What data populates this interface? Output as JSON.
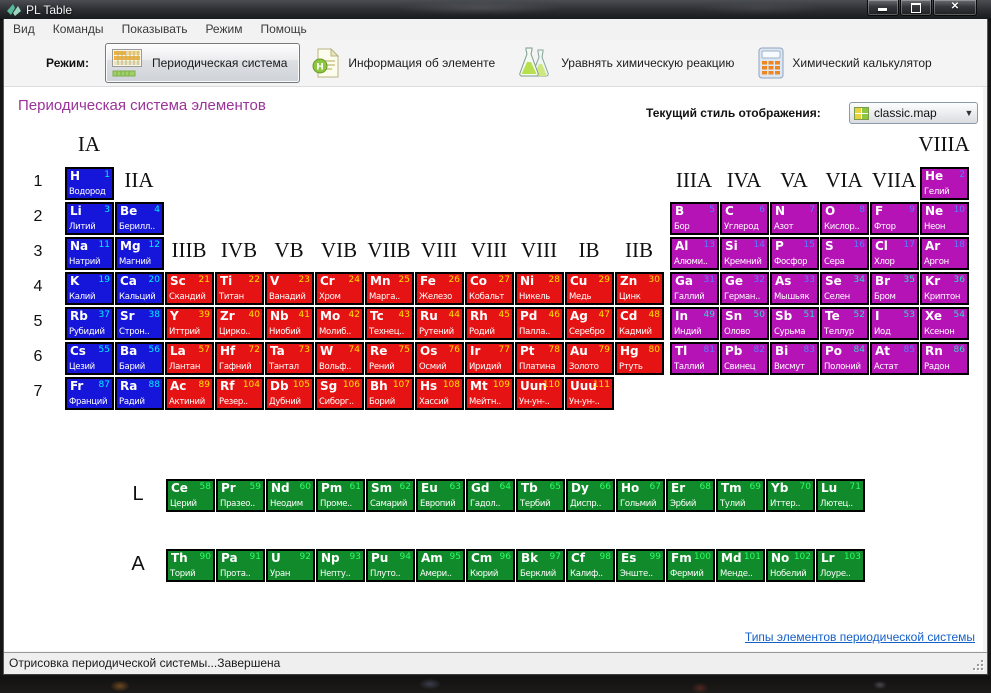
{
  "window": {
    "title": "PL Table"
  },
  "menu": {
    "items": [
      {
        "key": "view",
        "label": "Вид"
      },
      {
        "key": "commands",
        "label": "Команды"
      },
      {
        "key": "show",
        "label": "Показывать"
      },
      {
        "key": "mode",
        "label": "Режим"
      },
      {
        "key": "help",
        "label": "Помощь"
      }
    ]
  },
  "toolbar": {
    "mode_label": "Режим:",
    "buttons": [
      {
        "key": "periodic-system",
        "label": "Периодическая система",
        "icon": "periodic-table-icon",
        "selected": true
      },
      {
        "key": "element-info",
        "label": "Информация об элементе",
        "icon": "element-info-icon",
        "selected": false
      },
      {
        "key": "balance-reaction",
        "label": "Уравнять химическую реакцию",
        "icon": "flask-icon",
        "selected": false
      },
      {
        "key": "chem-calculator",
        "label": "Химический калькулятор",
        "icon": "calculator-icon",
        "selected": false
      }
    ]
  },
  "content": {
    "heading": "Периодическая система элементов",
    "style_label": "Текущий стиль отображения:",
    "style_value": "classic.map",
    "footer_link": "Типы элементов периодической системы"
  },
  "statusbar": {
    "text": "Отрисовка периодической системы...Завершена"
  },
  "table": {
    "colors": {
      "s": "#1616DA",
      "d": "#E51313",
      "p": "#B513B5",
      "f": "#108A2A"
    },
    "num_colors": {
      "s": "#00F0FF",
      "d": "#FFE000",
      "p": "#5A7CFF",
      "f": "#2BFF66",
      "cyan": "#2FD9C8"
    },
    "period_labels": [
      "1",
      "2",
      "3",
      "4",
      "5",
      "6",
      "7"
    ],
    "series_labels": [
      {
        "label": "L",
        "row": "L"
      },
      {
        "label": "A",
        "row": "A"
      }
    ],
    "group_labels": [
      {
        "text": "IA",
        "col": 1,
        "lv": "top"
      },
      {
        "text": "IIA",
        "col": 2,
        "lv": "row1"
      },
      {
        "text": "IIIB",
        "col": 3,
        "lv": "row3"
      },
      {
        "text": "IVB",
        "col": 4,
        "lv": "row3"
      },
      {
        "text": "VB",
        "col": 5,
        "lv": "row3"
      },
      {
        "text": "VIB",
        "col": 6,
        "lv": "row3"
      },
      {
        "text": "VIIB",
        "col": 7,
        "lv": "row3"
      },
      {
        "text": "VIII",
        "col": 8,
        "lv": "row3"
      },
      {
        "text": "VIII",
        "col": 9,
        "lv": "row3"
      },
      {
        "text": "VIII",
        "col": 10,
        "lv": "row3"
      },
      {
        "text": "IB",
        "col": 11,
        "lv": "row3"
      },
      {
        "text": "IIB",
        "col": 12,
        "lv": "row3"
      },
      {
        "text": "IIIA",
        "col": 13,
        "lv": "row1"
      },
      {
        "text": "IVA",
        "col": 14,
        "lv": "row1"
      },
      {
        "text": "VA",
        "col": 15,
        "lv": "row1"
      },
      {
        "text": "VIA",
        "col": 16,
        "lv": "row1"
      },
      {
        "text": "VIIA",
        "col": 17,
        "lv": "row1"
      },
      {
        "text": "VIIIA",
        "col": 18,
        "lv": "top"
      }
    ],
    "elements": [
      {
        "s": "H",
        "n": 1,
        "nm": "Водород",
        "b": "s",
        "p": 1,
        "c": 1
      },
      {
        "s": "He",
        "n": 2,
        "nm": "Гелий",
        "b": "p",
        "p": 1,
        "c": 18
      },
      {
        "s": "Li",
        "n": 3,
        "nm": "Литий",
        "b": "s",
        "p": 2,
        "c": 1
      },
      {
        "s": "Be",
        "n": 4,
        "nm": "Берилл..",
        "b": "s",
        "p": 2,
        "c": 2
      },
      {
        "s": "B",
        "n": 5,
        "nm": "Бор",
        "b": "p",
        "p": 2,
        "c": 13
      },
      {
        "s": "C",
        "n": 6,
        "nm": "Углерод",
        "b": "p",
        "p": 2,
        "c": 14
      },
      {
        "s": "N",
        "n": 7,
        "nm": "Азот",
        "b": "p",
        "p": 2,
        "c": 15
      },
      {
        "s": "O",
        "n": 8,
        "nm": "Кислор..",
        "b": "p",
        "p": 2,
        "c": 16
      },
      {
        "s": "F",
        "n": 9,
        "nm": "Фтор",
        "b": "p",
        "p": 2,
        "c": 17
      },
      {
        "s": "Ne",
        "n": 10,
        "nm": "Неон",
        "b": "p",
        "p": 2,
        "c": 18
      },
      {
        "s": "Na",
        "n": 11,
        "nm": "Натрий",
        "b": "s",
        "p": 3,
        "c": 1
      },
      {
        "s": "Mg",
        "n": 12,
        "nm": "Магний",
        "b": "s",
        "p": 3,
        "c": 2
      },
      {
        "s": "Al",
        "n": 13,
        "nm": "Алюми..",
        "b": "p",
        "p": 3,
        "c": 13
      },
      {
        "s": "Si",
        "n": 14,
        "nm": "Кремний",
        "b": "p",
        "p": 3,
        "c": 14
      },
      {
        "s": "P",
        "n": 15,
        "nm": "Фосфор",
        "b": "p",
        "p": 3,
        "c": 15
      },
      {
        "s": "S",
        "n": 16,
        "nm": "Сера",
        "b": "p",
        "p": 3,
        "c": 16
      },
      {
        "s": "Cl",
        "n": 17,
        "nm": "Хлор",
        "b": "p",
        "p": 3,
        "c": 17
      },
      {
        "s": "Ar",
        "n": 18,
        "nm": "Аргон",
        "b": "p",
        "p": 3,
        "c": 18
      },
      {
        "s": "K",
        "n": 19,
        "nm": "Калий",
        "b": "s",
        "p": 4,
        "c": 1
      },
      {
        "s": "Ca",
        "n": 20,
        "nm": "Кальций",
        "b": "s",
        "p": 4,
        "c": 2
      },
      {
        "s": "Sc",
        "n": 21,
        "nm": "Скандий",
        "b": "d",
        "p": 4,
        "c": 3
      },
      {
        "s": "Ti",
        "n": 22,
        "nm": "Титан",
        "b": "d",
        "p": 4,
        "c": 4
      },
      {
        "s": "V",
        "n": 23,
        "nm": "Ванадий",
        "b": "d",
        "p": 4,
        "c": 5
      },
      {
        "s": "Cr",
        "n": 24,
        "nm": "Хром",
        "b": "d",
        "p": 4,
        "c": 6
      },
      {
        "s": "Mn",
        "n": 25,
        "nm": "Марга..",
        "b": "d",
        "p": 4,
        "c": 7
      },
      {
        "s": "Fe",
        "n": 26,
        "nm": "Железо",
        "b": "d",
        "p": 4,
        "c": 8
      },
      {
        "s": "Co",
        "n": 27,
        "nm": "Кобальт",
        "b": "d",
        "p": 4,
        "c": 9
      },
      {
        "s": "Ni",
        "n": 28,
        "nm": "Никель",
        "b": "d",
        "p": 4,
        "c": 10
      },
      {
        "s": "Cu",
        "n": 29,
        "nm": "Медь",
        "b": "d",
        "p": 4,
        "c": 11
      },
      {
        "s": "Zn",
        "n": 30,
        "nm": "Цинк",
        "b": "d",
        "p": 4,
        "c": 12
      },
      {
        "s": "Ga",
        "n": 31,
        "nm": "Галлий",
        "b": "p",
        "p": 4,
        "c": 13
      },
      {
        "s": "Ge",
        "n": 32,
        "nm": "Герман..",
        "b": "p",
        "p": 4,
        "c": 14
      },
      {
        "s": "As",
        "n": 33,
        "nm": "Мышьяк",
        "b": "p",
        "p": 4,
        "c": 15
      },
      {
        "s": "Se",
        "n": 34,
        "nm": "Селен",
        "b": "p",
        "p": 4,
        "c": 16,
        "nc": "cyan"
      },
      {
        "s": "Br",
        "n": 35,
        "nm": "Бром",
        "b": "p",
        "p": 4,
        "c": 17,
        "nc": "cyan"
      },
      {
        "s": "Kr",
        "n": 36,
        "nm": "Криптон",
        "b": "p",
        "p": 4,
        "c": 18,
        "nc": "cyan"
      },
      {
        "s": "Rb",
        "n": 37,
        "nm": "Рубидий",
        "b": "s",
        "p": 5,
        "c": 1
      },
      {
        "s": "Sr",
        "n": 38,
        "nm": "Строн..",
        "b": "s",
        "p": 5,
        "c": 2
      },
      {
        "s": "Y",
        "n": 39,
        "nm": "Иттрий",
        "b": "d",
        "p": 5,
        "c": 3
      },
      {
        "s": "Zr",
        "n": 40,
        "nm": "Цирко..",
        "b": "d",
        "p": 5,
        "c": 4
      },
      {
        "s": "Nb",
        "n": 41,
        "nm": "Ниобий",
        "b": "d",
        "p": 5,
        "c": 5
      },
      {
        "s": "Mo",
        "n": 42,
        "nm": "Молиб..",
        "b": "d",
        "p": 5,
        "c": 6
      },
      {
        "s": "Tc",
        "n": 43,
        "nm": "Технец..",
        "b": "d",
        "p": 5,
        "c": 7
      },
      {
        "s": "Ru",
        "n": 44,
        "nm": "Рутений",
        "b": "d",
        "p": 5,
        "c": 8
      },
      {
        "s": "Rh",
        "n": 45,
        "nm": "Родий",
        "b": "d",
        "p": 5,
        "c": 9
      },
      {
        "s": "Pd",
        "n": 46,
        "nm": "Палла..",
        "b": "d",
        "p": 5,
        "c": 10
      },
      {
        "s": "Ag",
        "n": 47,
        "nm": "Серебро",
        "b": "d",
        "p": 5,
        "c": 11
      },
      {
        "s": "Cd",
        "n": 48,
        "nm": "Кадмий",
        "b": "d",
        "p": 5,
        "c": 12
      },
      {
        "s": "In",
        "n": 49,
        "nm": "Индий",
        "b": "p",
        "p": 5,
        "c": 13,
        "nc": "cyan"
      },
      {
        "s": "Sn",
        "n": 50,
        "nm": "Олово",
        "b": "p",
        "p": 5,
        "c": 14,
        "nc": "cyan"
      },
      {
        "s": "Sb",
        "n": 51,
        "nm": "Сурьма",
        "b": "p",
        "p": 5,
        "c": 15,
        "nc": "cyan"
      },
      {
        "s": "Te",
        "n": 52,
        "nm": "Теллур",
        "b": "p",
        "p": 5,
        "c": 16,
        "nc": "cyan"
      },
      {
        "s": "I",
        "n": 53,
        "nm": "Иод",
        "b": "p",
        "p": 5,
        "c": 17,
        "nc": "cyan"
      },
      {
        "s": "Xe",
        "n": 54,
        "nm": "Ксенон",
        "b": "p",
        "p": 5,
        "c": 18,
        "nc": "cyan"
      },
      {
        "s": "Cs",
        "n": 55,
        "nm": "Цезий",
        "b": "s",
        "p": 6,
        "c": 1
      },
      {
        "s": "Ba",
        "n": 56,
        "nm": "Барий",
        "b": "s",
        "p": 6,
        "c": 2
      },
      {
        "s": "La",
        "n": 57,
        "nm": "Лантан",
        "b": "d",
        "p": 6,
        "c": 3
      },
      {
        "s": "Hf",
        "n": 72,
        "nm": "Гафний",
        "b": "d",
        "p": 6,
        "c": 4
      },
      {
        "s": "Ta",
        "n": 73,
        "nm": "Тантал",
        "b": "d",
        "p": 6,
        "c": 5
      },
      {
        "s": "W",
        "n": 74,
        "nm": "Вольф..",
        "b": "d",
        "p": 6,
        "c": 6
      },
      {
        "s": "Re",
        "n": 75,
        "nm": "Рений",
        "b": "d",
        "p": 6,
        "c": 7
      },
      {
        "s": "Os",
        "n": 76,
        "nm": "Осмий",
        "b": "d",
        "p": 6,
        "c": 8
      },
      {
        "s": "Ir",
        "n": 77,
        "nm": "Иридий",
        "b": "d",
        "p": 6,
        "c": 9
      },
      {
        "s": "Pt",
        "n": 78,
        "nm": "Платина",
        "b": "d",
        "p": 6,
        "c": 10
      },
      {
        "s": "Au",
        "n": 79,
        "nm": "Золото",
        "b": "d",
        "p": 6,
        "c": 11
      },
      {
        "s": "Hg",
        "n": 80,
        "nm": "Ртуть",
        "b": "d",
        "p": 6,
        "c": 12
      },
      {
        "s": "Tl",
        "n": 81,
        "nm": "Таллий",
        "b": "p",
        "p": 6,
        "c": 13
      },
      {
        "s": "Pb",
        "n": 82,
        "nm": "Свинец",
        "b": "p",
        "p": 6,
        "c": 14
      },
      {
        "s": "Bi",
        "n": 83,
        "nm": "Висмут",
        "b": "p",
        "p": 6,
        "c": 15
      },
      {
        "s": "Po",
        "n": 84,
        "nm": "Полоний",
        "b": "p",
        "p": 6,
        "c": 16,
        "nc": "cyan"
      },
      {
        "s": "At",
        "n": 85,
        "nm": "Астат",
        "b": "p",
        "p": 6,
        "c": 17
      },
      {
        "s": "Rn",
        "n": 86,
        "nm": "Радон",
        "b": "p",
        "p": 6,
        "c": 18,
        "nc": "cyan"
      },
      {
        "s": "Fr",
        "n": 87,
        "nm": "Франций",
        "b": "s",
        "p": 7,
        "c": 1
      },
      {
        "s": "Ra",
        "n": 88,
        "nm": "Радий",
        "b": "s",
        "p": 7,
        "c": 2
      },
      {
        "s": "Ac",
        "n": 89,
        "nm": "Актиний",
        "b": "d",
        "p": 7,
        "c": 3
      },
      {
        "s": "Rf",
        "n": 104,
        "nm": "Резер..",
        "b": "d",
        "p": 7,
        "c": 4
      },
      {
        "s": "Db",
        "n": 105,
        "nm": "Дубний",
        "b": "d",
        "p": 7,
        "c": 5
      },
      {
        "s": "Sg",
        "n": 106,
        "nm": "Сиборг..",
        "b": "d",
        "p": 7,
        "c": 6
      },
      {
        "s": "Bh",
        "n": 107,
        "nm": "Борий",
        "b": "d",
        "p": 7,
        "c": 7
      },
      {
        "s": "Hs",
        "n": 108,
        "nm": "Хассий",
        "b": "d",
        "p": 7,
        "c": 8
      },
      {
        "s": "Mt",
        "n": 109,
        "nm": "Мейтн..",
        "b": "d",
        "p": 7,
        "c": 9
      },
      {
        "s": "Uun",
        "n": 110,
        "nm": "Ун-ун-..",
        "b": "d",
        "p": 7,
        "c": 10
      },
      {
        "s": "Uuu",
        "n": 111,
        "nm": "Ун-ун-..",
        "b": "d",
        "p": 7,
        "c": 11
      },
      {
        "s": "Ce",
        "n": 58,
        "nm": "Церий",
        "b": "f",
        "r": "L",
        "i": 0
      },
      {
        "s": "Pr",
        "n": 59,
        "nm": "Празео..",
        "b": "f",
        "r": "L",
        "i": 1
      },
      {
        "s": "Nd",
        "n": 60,
        "nm": "Неодим",
        "b": "f",
        "r": "L",
        "i": 2
      },
      {
        "s": "Pm",
        "n": 61,
        "nm": "Проме..",
        "b": "f",
        "r": "L",
        "i": 3
      },
      {
        "s": "Sm",
        "n": 62,
        "nm": "Самарий",
        "b": "f",
        "r": "L",
        "i": 4
      },
      {
        "s": "Eu",
        "n": 63,
        "nm": "Европий",
        "b": "f",
        "r": "L",
        "i": 5
      },
      {
        "s": "Gd",
        "n": 64,
        "nm": "Гадол..",
        "b": "f",
        "r": "L",
        "i": 6
      },
      {
        "s": "Tb",
        "n": 65,
        "nm": "Тербий",
        "b": "f",
        "r": "L",
        "i": 7
      },
      {
        "s": "Dy",
        "n": 66,
        "nm": "Диспр..",
        "b": "f",
        "r": "L",
        "i": 8
      },
      {
        "s": "Ho",
        "n": 67,
        "nm": "Гольмий",
        "b": "f",
        "r": "L",
        "i": 9
      },
      {
        "s": "Er",
        "n": 68,
        "nm": "Эрбий",
        "b": "f",
        "r": "L",
        "i": 10
      },
      {
        "s": "Tm",
        "n": 69,
        "nm": "Тулий",
        "b": "f",
        "r": "L",
        "i": 11
      },
      {
        "s": "Yb",
        "n": 70,
        "nm": "Иттер..",
        "b": "f",
        "r": "L",
        "i": 12
      },
      {
        "s": "Lu",
        "n": 71,
        "nm": "Лютец..",
        "b": "f",
        "r": "L",
        "i": 13
      },
      {
        "s": "Th",
        "n": 90,
        "nm": "Торий",
        "b": "f",
        "r": "A",
        "i": 0
      },
      {
        "s": "Pa",
        "n": 91,
        "nm": "Прота..",
        "b": "f",
        "r": "A",
        "i": 1
      },
      {
        "s": "U",
        "n": 92,
        "nm": "Уран",
        "b": "f",
        "r": "A",
        "i": 2
      },
      {
        "s": "Np",
        "n": 93,
        "nm": "Непту..",
        "b": "f",
        "r": "A",
        "i": 3
      },
      {
        "s": "Pu",
        "n": 94,
        "nm": "Плуто..",
        "b": "f",
        "r": "A",
        "i": 4
      },
      {
        "s": "Am",
        "n": 95,
        "nm": "Амери..",
        "b": "f",
        "r": "A",
        "i": 5
      },
      {
        "s": "Cm",
        "n": 96,
        "nm": "Кюрий",
        "b": "f",
        "r": "A",
        "i": 6
      },
      {
        "s": "Bk",
        "n": 97,
        "nm": "Берклий",
        "b": "f",
        "r": "A",
        "i": 7
      },
      {
        "s": "Cf",
        "n": 98,
        "nm": "Калиф..",
        "b": "f",
        "r": "A",
        "i": 8
      },
      {
        "s": "Es",
        "n": 99,
        "nm": "Энште..",
        "b": "f",
        "r": "A",
        "i": 9
      },
      {
        "s": "Fm",
        "n": 100,
        "nm": "Фермий",
        "b": "f",
        "r": "A",
        "i": 10
      },
      {
        "s": "Md",
        "n": 101,
        "nm": "Менде..",
        "b": "f",
        "r": "A",
        "i": 11
      },
      {
        "s": "No",
        "n": 102,
        "nm": "Нобелий",
        "b": "f",
        "r": "A",
        "i": 12
      },
      {
        "s": "Lr",
        "n": 103,
        "nm": "Лоуре..",
        "b": "f",
        "r": "A",
        "i": 13
      }
    ]
  }
}
